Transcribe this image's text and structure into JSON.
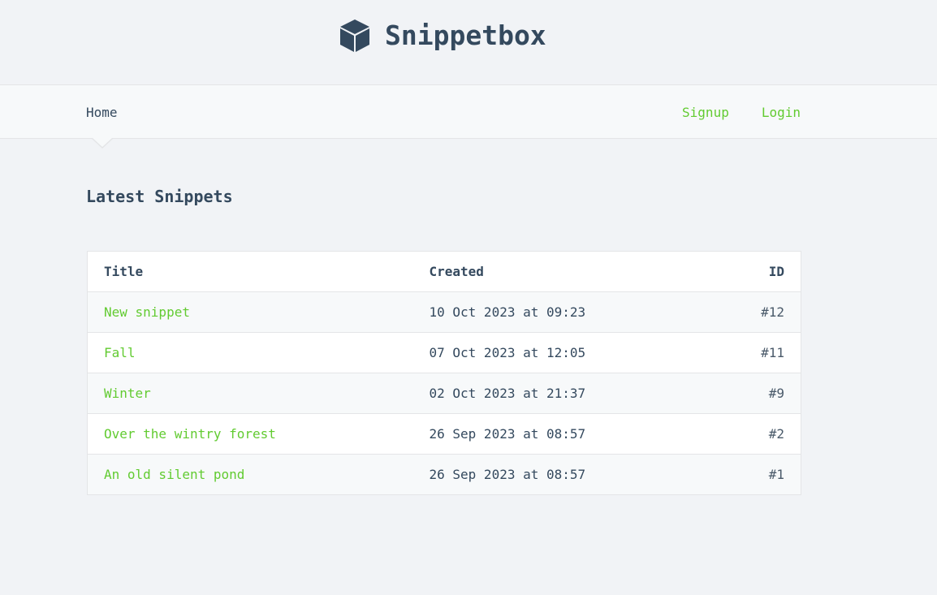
{
  "header": {
    "brand_icon": "cube-icon",
    "brand_name": "Snippetbox"
  },
  "nav": {
    "home": "Home",
    "signup": "Signup",
    "login": "Login",
    "accent_color": "#62cb31"
  },
  "main": {
    "heading": "Latest Snippets",
    "table": {
      "headers": {
        "title": "Title",
        "created": "Created",
        "id": "ID"
      },
      "rows": [
        {
          "title": "New snippet",
          "created": "10 Oct 2023 at 09:23",
          "id": "#12"
        },
        {
          "title": "Fall",
          "created": "07 Oct 2023 at 12:05",
          "id": "#11"
        },
        {
          "title": "Winter",
          "created": "02 Oct 2023 at 21:37",
          "id": "#9"
        },
        {
          "title": "Over the wintry forest",
          "created": "26 Sep 2023 at 08:57",
          "id": "#2"
        },
        {
          "title": "An old silent pond",
          "created": "26 Sep 2023 at 08:57",
          "id": "#1"
        }
      ]
    }
  }
}
